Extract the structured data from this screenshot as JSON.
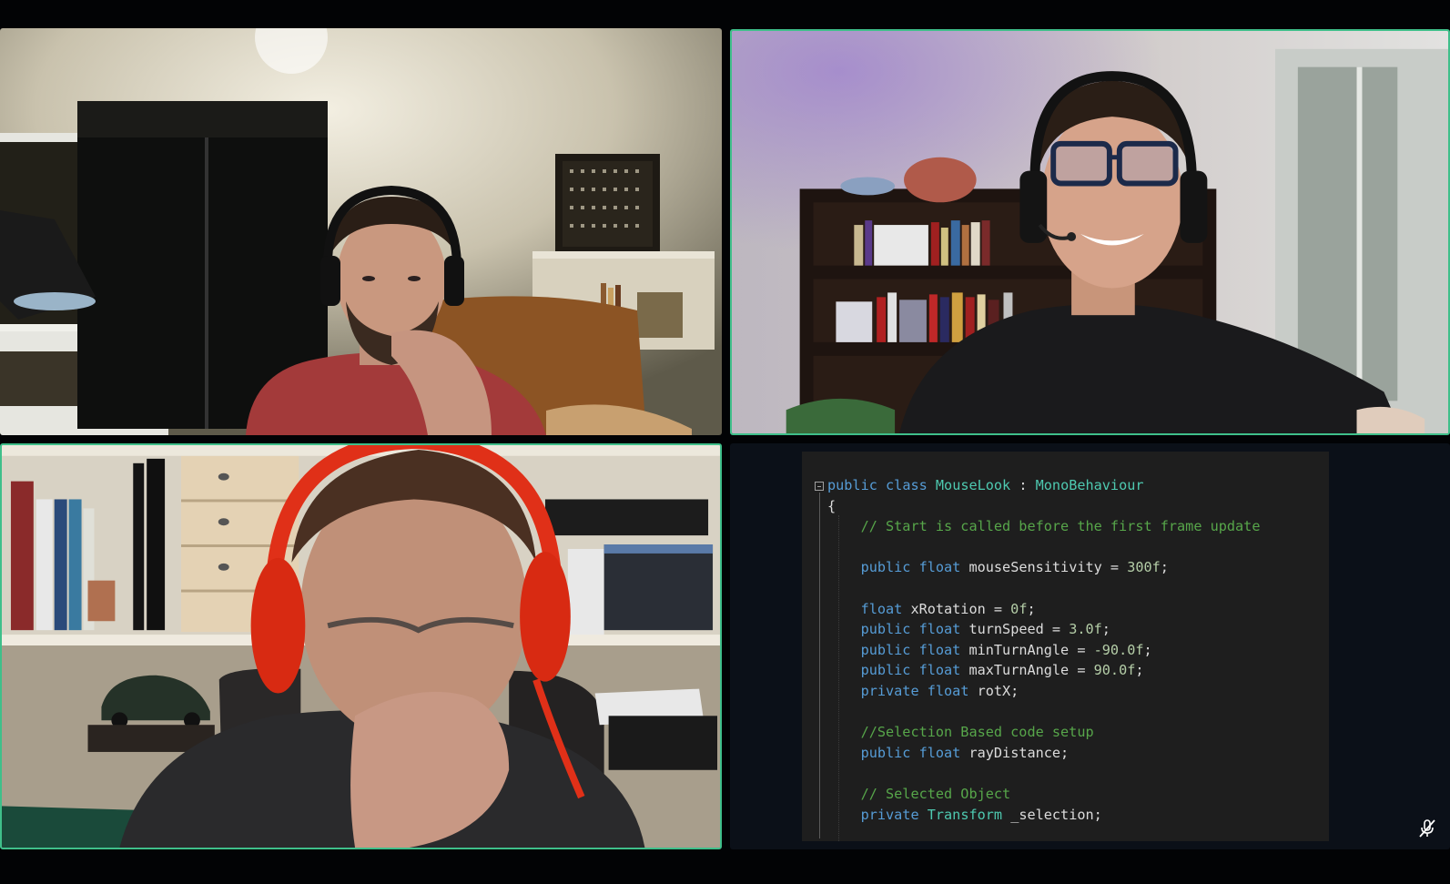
{
  "tiles": [
    {
      "id": "participant-1",
      "speaking": false
    },
    {
      "id": "participant-2",
      "speaking": true
    },
    {
      "id": "participant-3",
      "speaking": true
    },
    {
      "id": "screen-share",
      "speaking": false,
      "muted": true,
      "mic_icon": "mic-off-icon"
    }
  ],
  "colors": {
    "background": "#000000",
    "active_speaker_border": "#3fbf8a",
    "editor_bg": "#1e1e1e",
    "keyword": "#569cd6",
    "type": "#4ec9b0",
    "comment": "#57a64a",
    "number": "#b5cea8",
    "identifier": "#dcdcdc"
  },
  "code": {
    "lines": [
      [
        {
          "t": "public",
          "c": "kw"
        },
        {
          "t": " "
        },
        {
          "t": "class",
          "c": "kw"
        },
        {
          "t": " "
        },
        {
          "t": "MouseLook",
          "c": "type"
        },
        {
          "t": " : "
        },
        {
          "t": "MonoBehaviour",
          "c": "type"
        }
      ],
      [
        {
          "t": "{"
        }
      ],
      [
        {
          "t": "    "
        },
        {
          "t": "// Start is called before the first frame update",
          "c": "cm"
        }
      ],
      [],
      [
        {
          "t": "    "
        },
        {
          "t": "public",
          "c": "kw"
        },
        {
          "t": " "
        },
        {
          "t": "float",
          "c": "kw"
        },
        {
          "t": " mouseSensitivity = "
        },
        {
          "t": "300f",
          "c": "num"
        },
        {
          "t": ";"
        }
      ],
      [],
      [
        {
          "t": "    "
        },
        {
          "t": "float",
          "c": "kw"
        },
        {
          "t": " xRotation = "
        },
        {
          "t": "0f",
          "c": "num"
        },
        {
          "t": ";"
        }
      ],
      [
        {
          "t": "    "
        },
        {
          "t": "public",
          "c": "kw"
        },
        {
          "t": " "
        },
        {
          "t": "float",
          "c": "kw"
        },
        {
          "t": " turnSpeed = "
        },
        {
          "t": "3.0f",
          "c": "num"
        },
        {
          "t": ";"
        }
      ],
      [
        {
          "t": "    "
        },
        {
          "t": "public",
          "c": "kw"
        },
        {
          "t": " "
        },
        {
          "t": "float",
          "c": "kw"
        },
        {
          "t": " minTurnAngle = "
        },
        {
          "t": "-90.0f",
          "c": "num"
        },
        {
          "t": ";"
        }
      ],
      [
        {
          "t": "    "
        },
        {
          "t": "public",
          "c": "kw"
        },
        {
          "t": " "
        },
        {
          "t": "float",
          "c": "kw"
        },
        {
          "t": " maxTurnAngle = "
        },
        {
          "t": "90.0f",
          "c": "num"
        },
        {
          "t": ";"
        }
      ],
      [
        {
          "t": "    "
        },
        {
          "t": "private",
          "c": "kw"
        },
        {
          "t": " "
        },
        {
          "t": "float",
          "c": "kw"
        },
        {
          "t": " rotX;"
        }
      ],
      [],
      [
        {
          "t": "    "
        },
        {
          "t": "//Selection Based code setup",
          "c": "cm"
        }
      ],
      [
        {
          "t": "    "
        },
        {
          "t": "public",
          "c": "kw"
        },
        {
          "t": " "
        },
        {
          "t": "float",
          "c": "kw"
        },
        {
          "t": " rayDistance;"
        }
      ],
      [],
      [
        {
          "t": "    "
        },
        {
          "t": "// Selected Object",
          "c": "cm"
        }
      ],
      [
        {
          "t": "    "
        },
        {
          "t": "private",
          "c": "kw"
        },
        {
          "t": " "
        },
        {
          "t": "Transform",
          "c": "type"
        },
        {
          "t": " _selection;"
        }
      ]
    ]
  }
}
